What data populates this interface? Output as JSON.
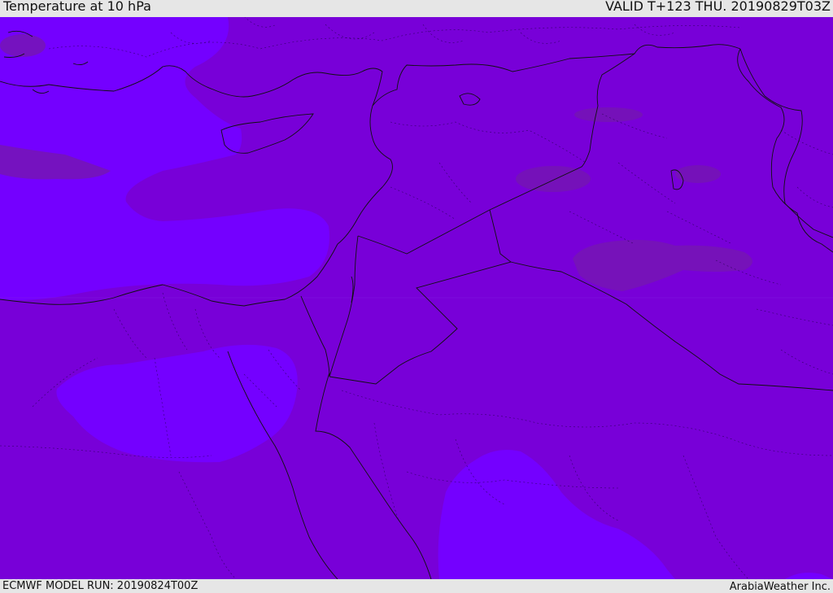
{
  "header": {
    "title": "Temperature at 10 hPa",
    "valid": "VALID T+123 THU. 20190829T03Z"
  },
  "footer": {
    "model_run": "ECMWF MODEL RUN: 20190824T00Z",
    "credit": "ArabiaWeather Inc."
  },
  "map": {
    "colors": {
      "base": "#7800d8",
      "warm_patch": "#7515b4",
      "cool_patch": "#7400ff",
      "border": "#111111",
      "graticule": "#8a2be2"
    }
  }
}
